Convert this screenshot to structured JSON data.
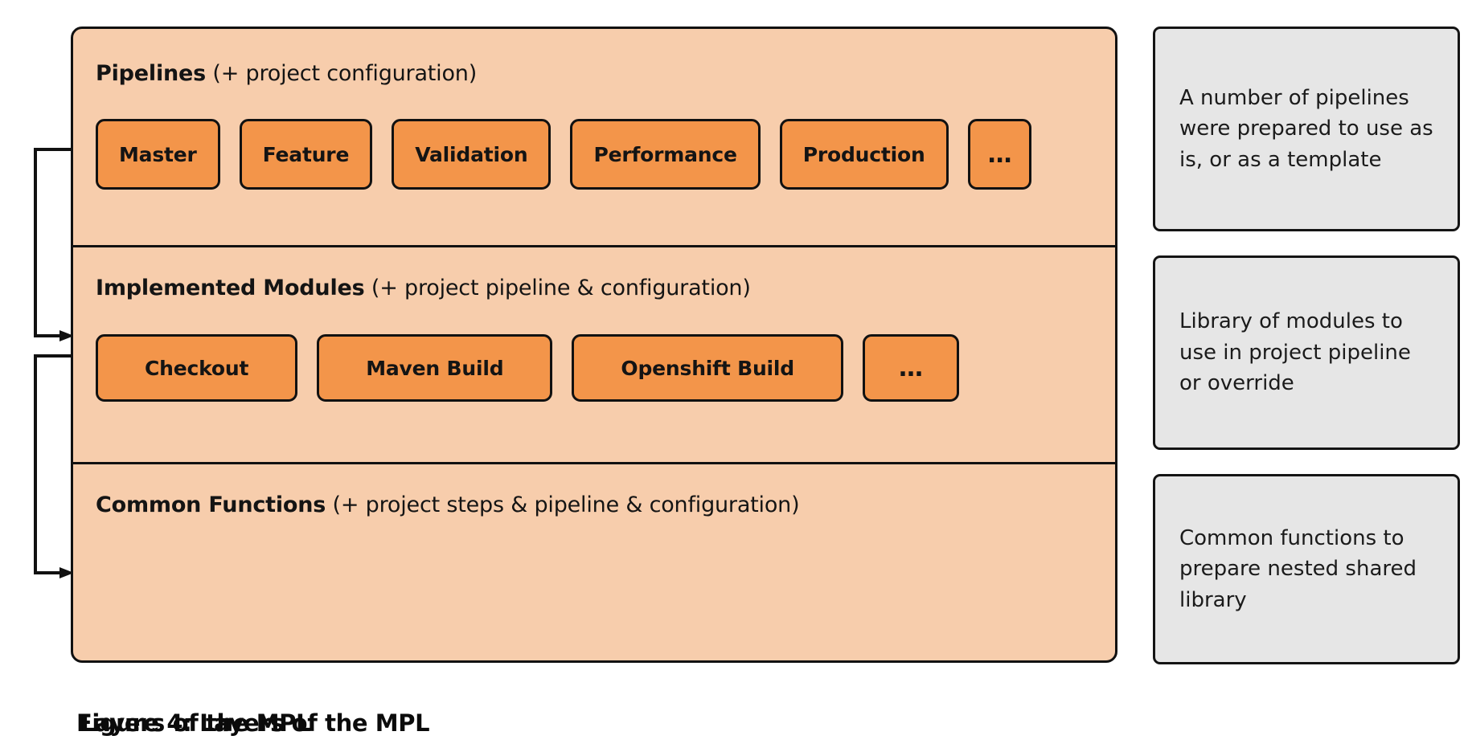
{
  "diagram": {
    "layers": [
      {
        "id": "pipelines",
        "title_bold": "Pipelines",
        "title_light": " (+ project configuration)",
        "chips": [
          "Master",
          "Feature",
          "Validation",
          "Performance",
          "Production",
          "…"
        ]
      },
      {
        "id": "modules",
        "title_bold": "Implemented Modules",
        "title_light": " (+ project pipeline & configuration)",
        "chips": [
          "Checkout",
          "Maven Build",
          "Openshift Build",
          "…"
        ]
      },
      {
        "id": "common",
        "title_bold": "Common Functions",
        "title_light": " (+ project steps & pipeline & configuration)",
        "chips": []
      }
    ],
    "notes": [
      {
        "id": "note-pipelines",
        "text": "A number of pipelines were prepared to use as is, or as a template"
      },
      {
        "id": "note-modules",
        "text": "Library of modules to use in project pipeline or override"
      },
      {
        "id": "note-common",
        "text": "Common functions to prepare nested shared library"
      }
    ],
    "captions": {
      "primary": "Figure 4: Layers of the MPL",
      "secondary": "Layers of the MPL"
    },
    "colors": {
      "layer_fill": "#F7CDAC",
      "chip_fill": "#F3954A",
      "note_fill": "#E6E6E6",
      "stroke": "#111111"
    }
  }
}
